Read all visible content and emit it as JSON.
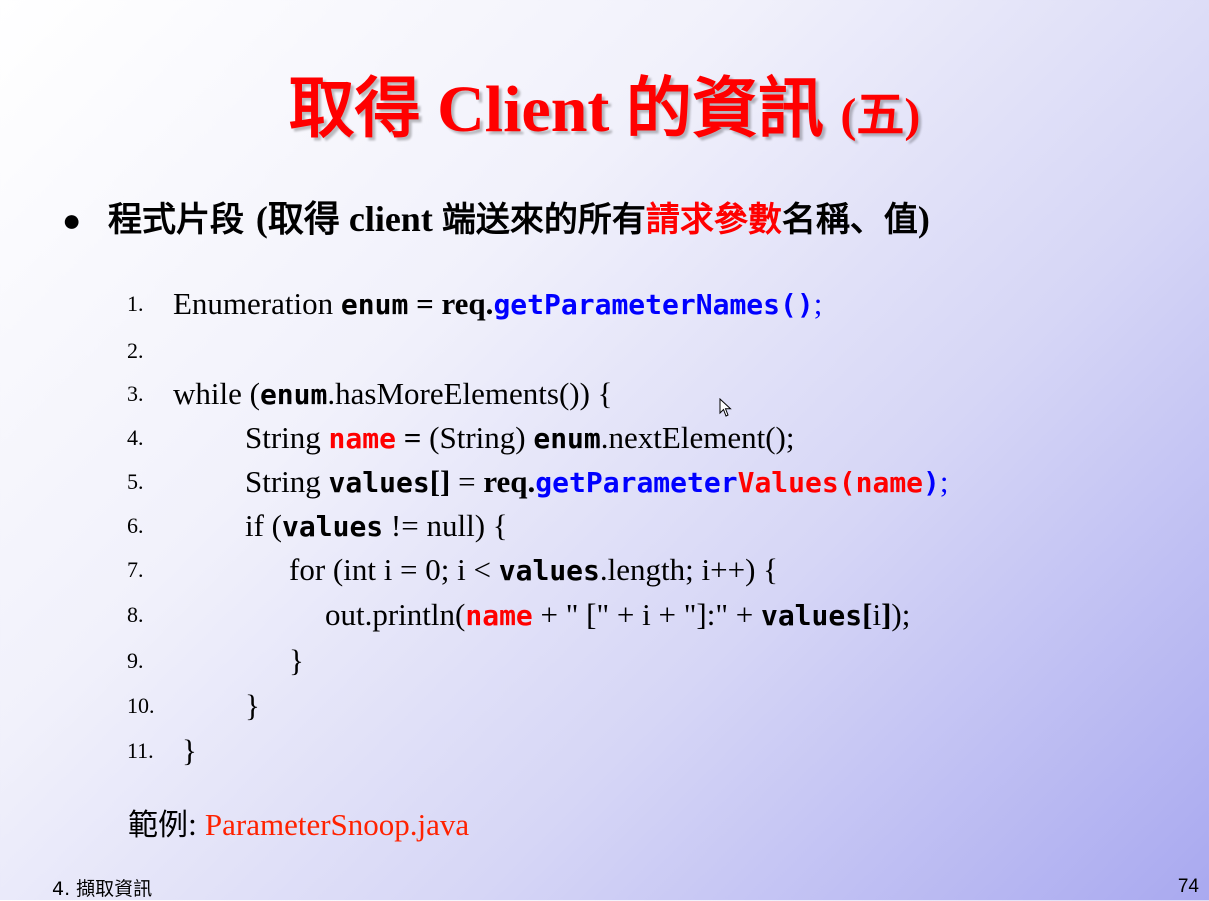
{
  "title": {
    "main": "取得 Client 的資訊 ",
    "paren": "(五)"
  },
  "bullet": {
    "zh1": "程式片段 ",
    "p1": "(取得 ",
    "client": "client ",
    "zh2": "端送來的所有",
    "zh_red": "請求參數",
    "zh3": "名稱、值",
    "p2": ")"
  },
  "code": {
    "nums": [
      "1.",
      "2.",
      "3.",
      "4.",
      "5.",
      "6.",
      "7.",
      "8.",
      "9.",
      "10.",
      "11."
    ],
    "l1": {
      "a": "Enumeration ",
      "b": "enum",
      "c": " = req.",
      "d": "getParameterNames()",
      "e": ";"
    },
    "l3": {
      "a": "while (",
      "b": "enum",
      "c": ".hasMoreElements()) {"
    },
    "l4": {
      "a": "String ",
      "b": "name",
      "c": " = ",
      "d": "(String) ",
      "e": "enum",
      "f": ".nextElement();"
    },
    "l5": {
      "a": "String  ",
      "b": "values",
      "c": "[] ",
      "d": "= ",
      "e": "req.",
      "f": "getParameter",
      "g": "Values",
      "h": "(",
      "i": "name",
      "j": ")",
      "k": ";"
    },
    "l6": {
      "a": "if (",
      "b": "values",
      "c": " != null) {"
    },
    "l7": {
      "a": "for (int i = 0; i < ",
      "b": "values",
      "c": ".length; i++) {"
    },
    "l8": {
      "a": "out.println(",
      "b": "name",
      "c": " + \" [\" + i + \"]:\" + ",
      "d": "values",
      "e": "[",
      "f": "i",
      "g": "]",
      "h": ");"
    },
    "l9": "}",
    "l10": "}",
    "l11": "}"
  },
  "example": {
    "label": "範例",
    "colon": ": ",
    "file": "ParameterSnoop.java"
  },
  "footer": {
    "section": "4. 擷取資訊",
    "page": "74"
  },
  "colors": {
    "title": "#ff0000",
    "keyword_red": "#ff0000",
    "method_blue": "#0000ff",
    "file_link": "#ff2200"
  }
}
